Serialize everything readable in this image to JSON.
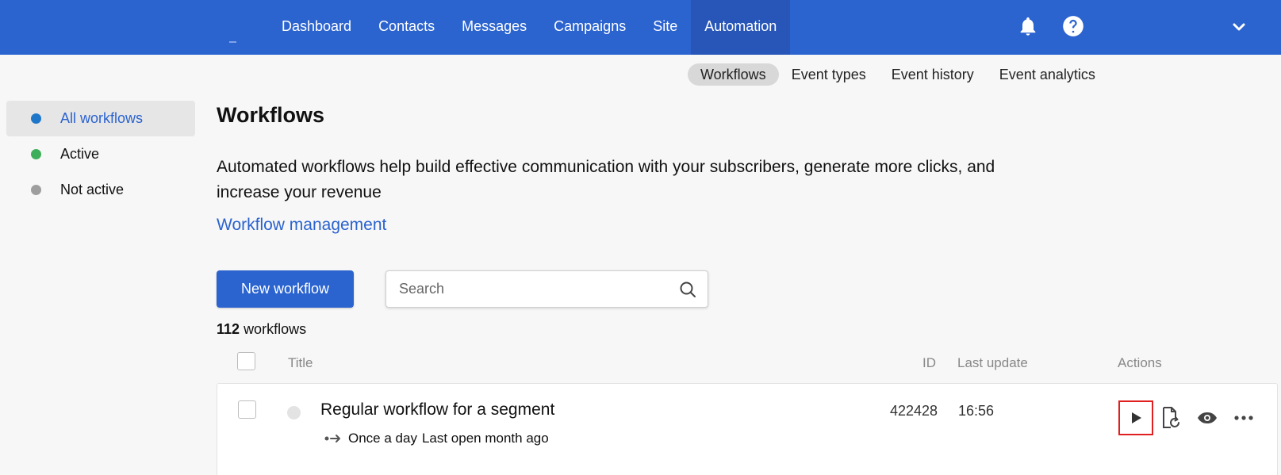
{
  "nav": {
    "items": [
      "Dashboard",
      "Contacts",
      "Messages",
      "Campaigns",
      "Site",
      "Automation"
    ],
    "active": "Automation"
  },
  "subnav": {
    "items": [
      "Workflows",
      "Event types",
      "Event history",
      "Event analytics"
    ],
    "active": "Workflows"
  },
  "sidebar": {
    "items": [
      {
        "label": "All workflows",
        "color": "#1f77c9"
      },
      {
        "label": "Active",
        "color": "#3fae5a"
      },
      {
        "label": "Not active",
        "color": "#9e9e9e"
      }
    ]
  },
  "main": {
    "title": "Workflows",
    "description": "Automated workflows help build effective communication with your subscribers, generate more clicks, and increase your revenue",
    "link": "Workflow management",
    "new_button": "New workflow",
    "search_placeholder": "Search",
    "count_number": "112",
    "count_label": "workflows"
  },
  "table": {
    "headers": {
      "title": "Title",
      "id": "ID",
      "last_update": "Last update",
      "actions": "Actions"
    },
    "rows": [
      {
        "title": "Regular workflow for a segment",
        "schedule": "Once a day",
        "last_open": "Last open month ago",
        "id": "422428",
        "last_update": "16:56"
      }
    ]
  },
  "colors": {
    "brand": "#2b63cf",
    "highlight": "#e02020"
  }
}
